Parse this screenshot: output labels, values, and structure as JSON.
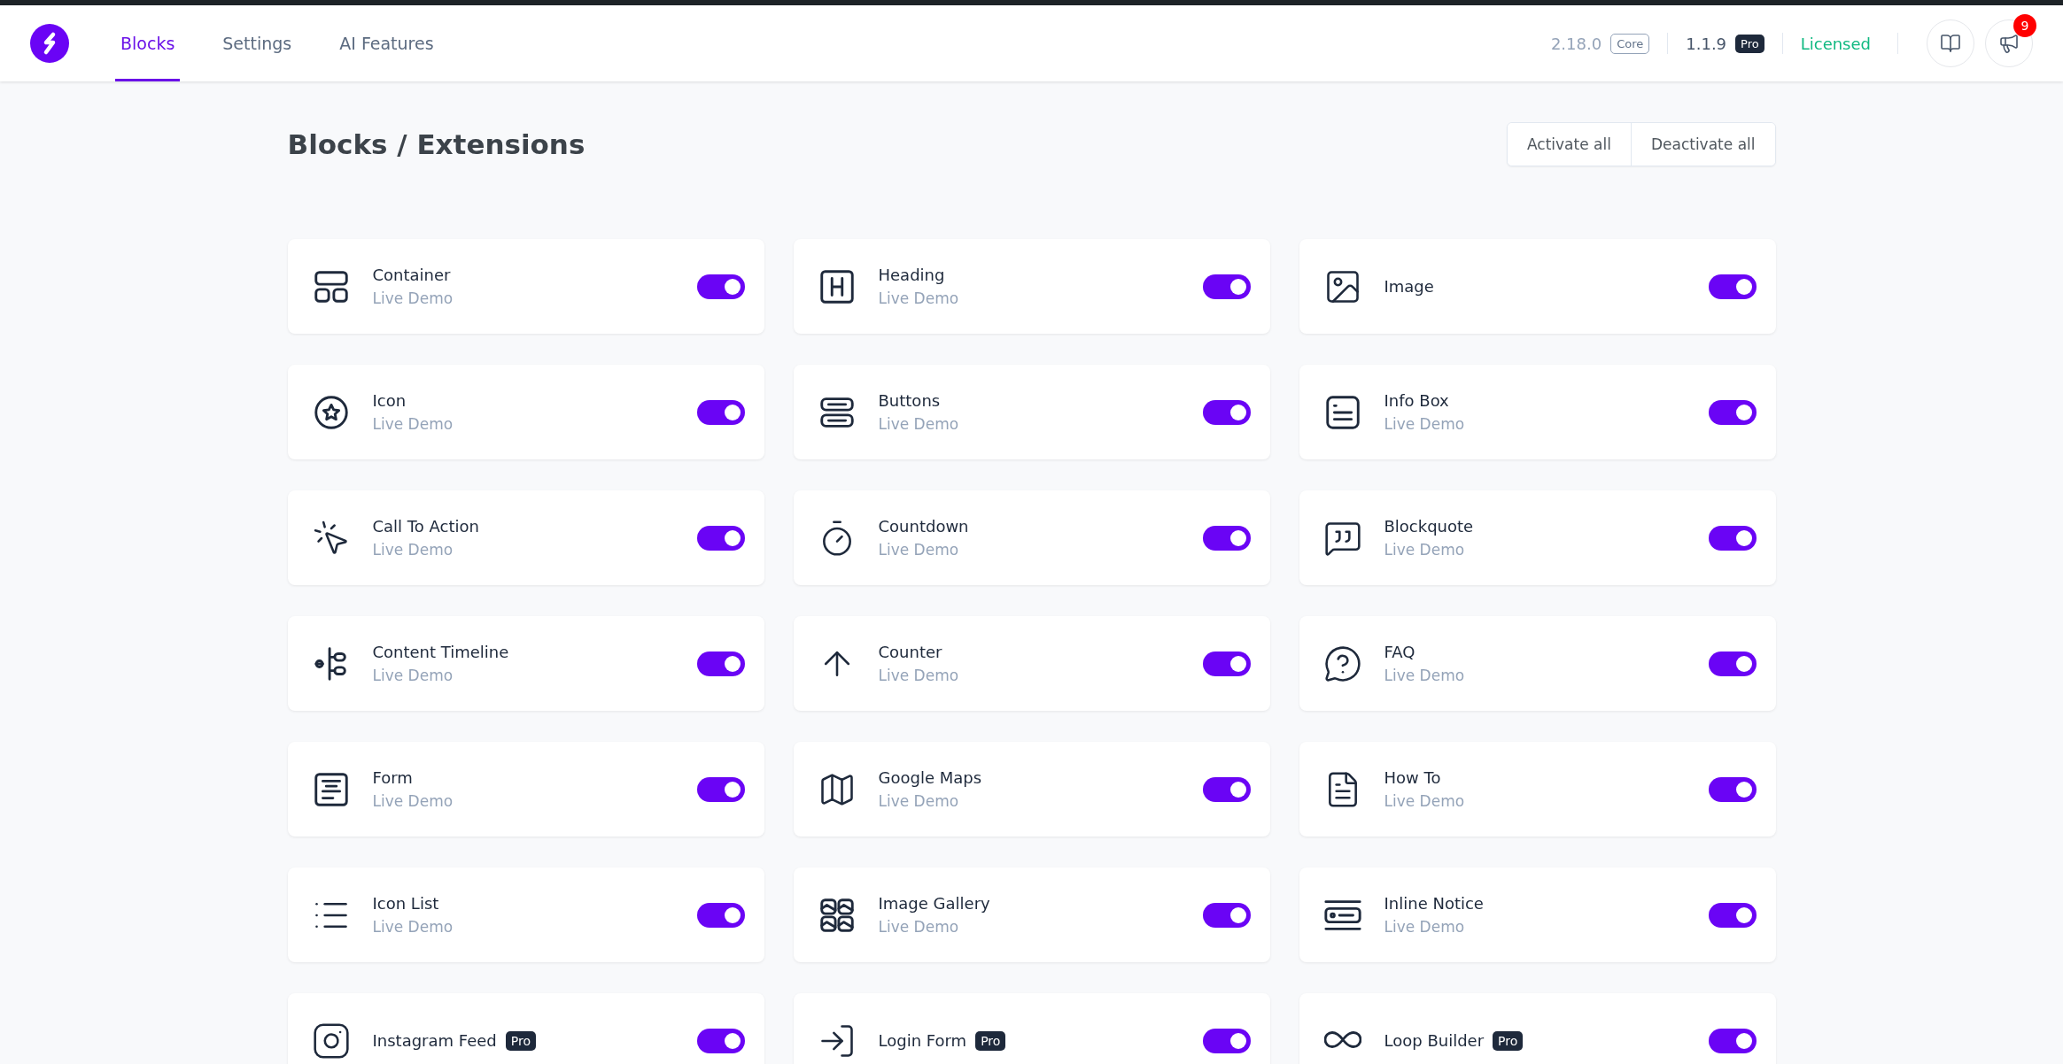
{
  "nav": {
    "tabs": [
      {
        "label": "Blocks",
        "selected": true
      },
      {
        "label": "Settings",
        "selected": false
      },
      {
        "label": "AI Features",
        "selected": false
      }
    ],
    "core_version": "2.18.0",
    "core_badge": "Core",
    "pro_version": "1.1.9",
    "pro_badge": "Pro",
    "license": "Licensed",
    "notifications": "9"
  },
  "title": "Blocks / Extensions",
  "actions": [
    "Activate all",
    "Deactivate all"
  ],
  "blocks": [
    {
      "name": "Container",
      "link": "Live Demo",
      "on": true
    },
    {
      "name": "Heading",
      "link": "Live Demo",
      "on": true
    },
    {
      "name": "Image",
      "on": true
    },
    {
      "name": "Icon",
      "link": "Live Demo",
      "on": true
    },
    {
      "name": "Buttons",
      "link": "Live Demo",
      "on": true
    },
    {
      "name": "Info Box",
      "link": "Live Demo",
      "on": true
    },
    {
      "name": "Call To Action",
      "link": "Live Demo",
      "on": true
    },
    {
      "name": "Countdown",
      "link": "Live Demo",
      "on": true
    },
    {
      "name": "Blockquote",
      "link": "Live Demo",
      "on": true
    },
    {
      "name": "Content Timeline",
      "link": "Live Demo",
      "on": true
    },
    {
      "name": "Counter",
      "link": "Live Demo",
      "on": true
    },
    {
      "name": "FAQ",
      "link": "Live Demo",
      "on": true
    },
    {
      "name": "Form",
      "link": "Live Demo",
      "on": true
    },
    {
      "name": "Google Maps",
      "link": "Live Demo",
      "on": true
    },
    {
      "name": "How To",
      "link": "Live Demo",
      "on": true
    },
    {
      "name": "Icon List",
      "link": "Live Demo",
      "on": true
    },
    {
      "name": "Image Gallery",
      "link": "Live Demo",
      "on": true
    },
    {
      "name": "Inline Notice",
      "link": "Live Demo",
      "on": true
    },
    {
      "name": "Instagram Feed",
      "badge": "Pro",
      "on": true
    },
    {
      "name": "Login Form",
      "badge": "Pro",
      "on": true
    },
    {
      "name": "Loop Builder",
      "badge": "Pro",
      "on": true
    }
  ]
}
